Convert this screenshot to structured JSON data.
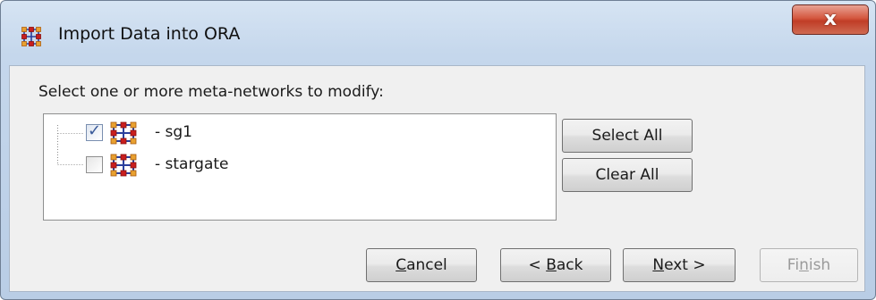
{
  "window": {
    "title": "Import Data into ORA",
    "close_glyph": "x",
    "app_icon": "ora-network-icon"
  },
  "main": {
    "instruction": "Select one or more meta-networks to modify:",
    "tree": {
      "items": [
        {
          "label": "- sg1",
          "checked": true,
          "icon": "meta-network-icon"
        },
        {
          "label": "- stargate",
          "checked": false,
          "icon": "meta-network-icon"
        }
      ]
    },
    "select_all_label": "Select All",
    "clear_all_label": "Clear All"
  },
  "footer": {
    "cancel": {
      "mnemonic": "C",
      "rest": "ancel"
    },
    "back": {
      "prefix": "< ",
      "mnemonic": "B",
      "rest": "ack"
    },
    "next": {
      "mnemonic": "N",
      "rest": "ext >"
    },
    "finish": {
      "prefix": "Fi",
      "mnemonic": "n",
      "rest": "ish",
      "enabled": false
    }
  },
  "colors": {
    "window_frame": "#c5d7ec",
    "content_bg": "#f0f0f0",
    "close_button": "#c9452d",
    "node_orange": "#e8a030",
    "edge_blue": "#2a3f9c",
    "node_red": "#c81e1e"
  }
}
